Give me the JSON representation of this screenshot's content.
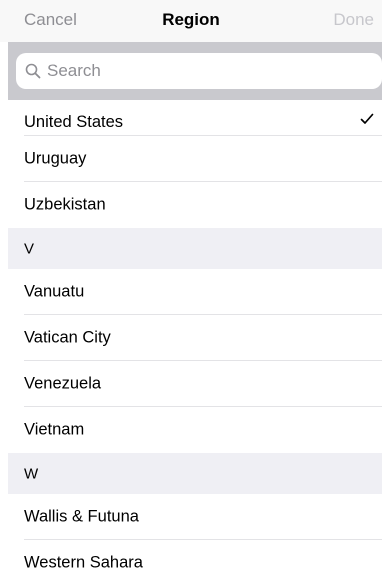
{
  "nav": {
    "cancel_label": "Cancel",
    "title": "Region",
    "done_label": "Done"
  },
  "search": {
    "placeholder": "Search",
    "icon": "search-icon"
  },
  "list": {
    "selected_icon": "checkmark-icon",
    "rows": [
      {
        "label": "United States",
        "selected": true
      },
      {
        "label": "Uruguay"
      },
      {
        "label": "Uzbekistan"
      }
    ],
    "section_v": {
      "header": "V",
      "rows": [
        {
          "label": "Vanuatu"
        },
        {
          "label": "Vatican City"
        },
        {
          "label": "Venezuela"
        },
        {
          "label": "Vietnam"
        }
      ]
    },
    "section_w": {
      "header": "W",
      "rows": [
        {
          "label": "Wallis & Futuna"
        },
        {
          "label": "Western Sahara"
        }
      ]
    }
  },
  "colors": {
    "accent_disabled": "#c7c7cc",
    "secondary_text": "#8e8e93",
    "section_background": "#efeff4",
    "search_background": "#c9c9ce"
  }
}
